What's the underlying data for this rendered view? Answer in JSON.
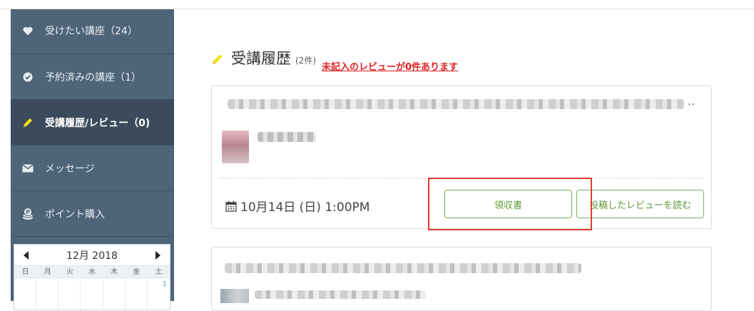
{
  "sidebar": {
    "items": [
      {
        "label": "受けたい講座（24）",
        "icon": "heart-icon"
      },
      {
        "label": "予約済みの講座（1）",
        "icon": "check-circle-icon"
      },
      {
        "label": "受講履歴/レビュー（0)",
        "icon": "pencil-icon",
        "active": true
      },
      {
        "label": "メッセージ",
        "icon": "envelope-icon"
      },
      {
        "label": "ポイント購入",
        "icon": "coins-icon"
      }
    ],
    "calendar": {
      "month_label": "12月 2018",
      "weekdays": [
        "日",
        "月",
        "火",
        "水",
        "木",
        "金",
        "土"
      ],
      "first_row": [
        "",
        "",
        "",
        "",
        "",
        "",
        "1"
      ]
    }
  },
  "main": {
    "title": "受講履歴",
    "count": "(2件)",
    "warning": "未記入のレビューが0件あります",
    "cards": [
      {
        "more": "··",
        "date": "10月14日 (日) 1:00PM",
        "receipt_button": "領収書",
        "review_button": "投稿したレビューを読む"
      }
    ]
  },
  "colors": {
    "sidebar_bg": "#4e6479",
    "sidebar_active": "#3b4b5b",
    "button_green": "#7fb15a",
    "warning_red": "#e02020",
    "highlight_red": "#e23b2e"
  }
}
